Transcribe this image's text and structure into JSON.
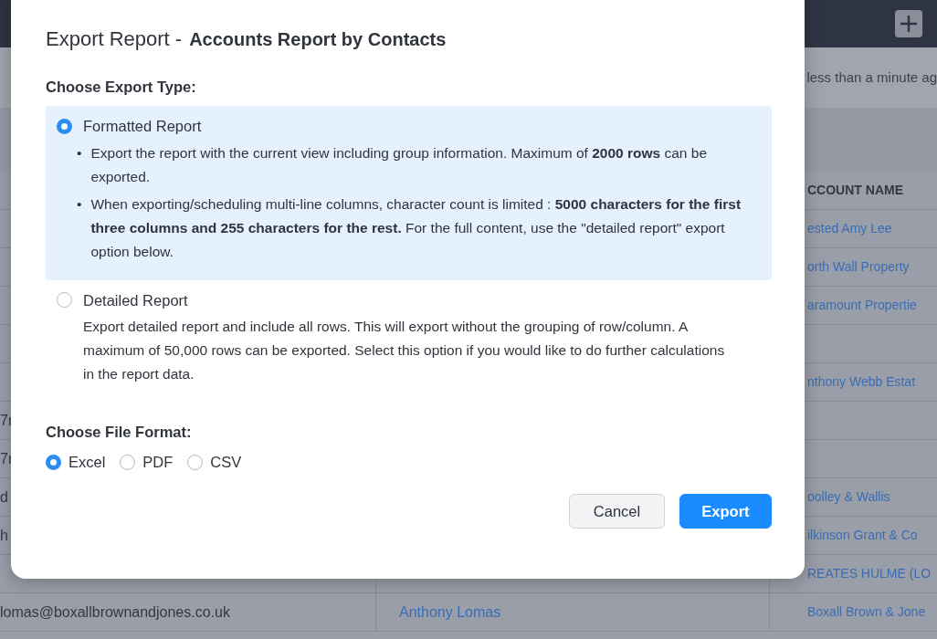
{
  "background": {
    "updated": "less than a minute ag",
    "table": {
      "columns": [
        "",
        "",
        "CCOUNT NAME"
      ],
      "rows": [
        [
          "",
          "",
          "ested Amy Lee"
        ],
        [
          "",
          "",
          "orth Wall Property"
        ],
        [
          "",
          "",
          "aramount Propertie"
        ],
        [
          "",
          "",
          ""
        ],
        [
          "",
          "",
          "nthony Webb Estat"
        ],
        [
          "7r",
          "",
          ""
        ],
        [
          "7r",
          "",
          ""
        ],
        [
          "d",
          "",
          "oolley & Wallis"
        ],
        [
          "h",
          "",
          "ilkinson Grant & Co"
        ],
        [
          "",
          "",
          "REATES HULME (LO"
        ],
        [
          "lomas@boxallbrownandjones.co.uk",
          "Anthony Lomas",
          "Boxall Brown & Jone"
        ]
      ]
    }
  },
  "dialog": {
    "title": "Export Report -",
    "subtitle": "Accounts Report by Contacts",
    "export_type": {
      "label": "Choose Export Type:",
      "options": [
        {
          "kind": "bullets",
          "label": "Formatted Report",
          "selected": true,
          "marker": "•",
          "bullets": [
            "Export the report with the current view including group information. Maximum of **2000 rows** can be exported.",
            "When exporting/scheduling multi-line columns, character count is limited : **5000 characters for the first three columns and 255 characters for the rest.** For the full content, use the \"detailed report\" export option below."
          ]
        },
        {
          "kind": "text",
          "label": "Detailed Report",
          "selected": false,
          "description": "Export detailed report and include all rows. This will export without the grouping of row/column. A maximum of 50,000 rows can be exported. Select this option if you would like to do further calculations in the report data."
        }
      ]
    },
    "file_format": {
      "label": "Choose File Format:",
      "options": [
        {
          "label": "Excel",
          "selected": true
        },
        {
          "label": "PDF",
          "selected": false
        },
        {
          "label": "CSV",
          "selected": false
        }
      ]
    },
    "buttons": [
      {
        "kind": "secondary",
        "label": "Cancel"
      },
      {
        "kind": "primary",
        "label": "Export"
      }
    ]
  }
}
